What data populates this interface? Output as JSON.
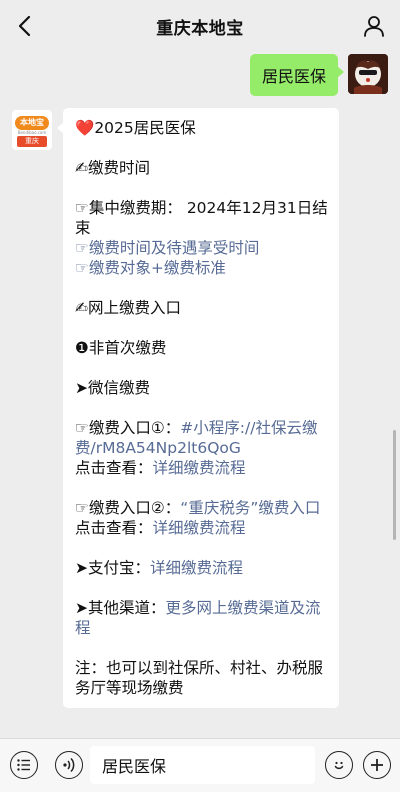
{
  "header": {
    "title": "重庆本地宝"
  },
  "outgoing": {
    "text": "居民医保"
  },
  "incoming": {
    "avatar": {
      "logo_text": "本地宝",
      "logo_url_text": "Bendibao.com",
      "city": "重庆"
    },
    "title": "2025居民医保",
    "pay_time_heading": "✍缴费时间",
    "collect_period": "☞集中缴费期： 2024年12月31日结束",
    "link1": "☞缴费时间及待遇享受时间",
    "link2": "☞缴费对象+缴费标准",
    "online_heading": "✍网上缴费入口",
    "non_first": "❶非首次缴费",
    "wechat": "➤微信缴费",
    "entry1_prefix": "☞缴费入口①：",
    "entry1_link": "#小程序://社保云缴费/rM8A54Np2lt6QoG",
    "entry1_view_prefix": "点击查看：",
    "entry1_view_link": "详细缴费流程",
    "entry2_prefix": "☞缴费入口②：",
    "entry2_link": "“重庆税务”缴费入口",
    "entry2_view_prefix": "点击查看：",
    "entry2_view_link": "详细缴费流程",
    "alipay_prefix": "➤支付宝：",
    "alipay_link": "详细缴费流程",
    "other_prefix": "➤其他渠道：",
    "other_link": "更多网上缴费渠道及流程",
    "note": "注：也可以到社保所、村社、办税服务厅等现场缴费"
  },
  "input": {
    "text": "居民医保"
  },
  "icons": [
    "back-icon",
    "person-icon",
    "list-icon",
    "voice-icon",
    "emoji-icon",
    "plus-icon"
  ]
}
